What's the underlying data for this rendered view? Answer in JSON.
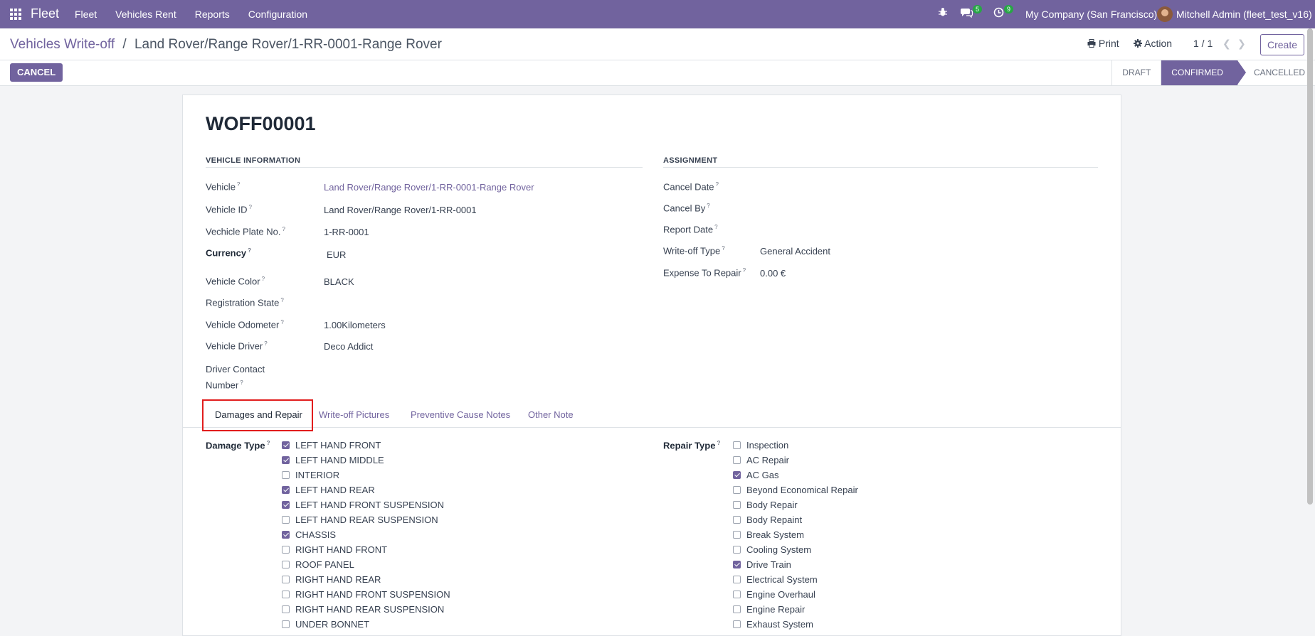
{
  "navbar": {
    "brand": "Fleet",
    "menu": [
      "Fleet",
      "Vehicles Rent",
      "Reports",
      "Configuration"
    ],
    "messages_count": "5",
    "activities_count": "9",
    "company": "My Company (San Francisco)",
    "user": "Mitchell Admin (fleet_test_v16)"
  },
  "control_panel": {
    "breadcrumb_parent": "Vehicles Write-off",
    "breadcrumb_sep": "/",
    "breadcrumb_current": "Land Rover/Range Rover/1-RR-0001-Range Rover",
    "print_label": "Print",
    "action_label": "Action",
    "pager": "1 / 1",
    "create_label": "Create",
    "cancel_label": "CANCEL",
    "statuses": [
      "DRAFT",
      "CONFIRMED",
      "CANCELLED"
    ],
    "active_status": "CONFIRMED"
  },
  "form": {
    "name": "WOFF00001",
    "vehicle_info_title": "VEHICLE INFORMATION",
    "assignment_title": "ASSIGNMENT",
    "vehicle_fields": [
      {
        "label": "Vehicle",
        "value": "Land Rover/Range Rover/1-RR-0001-Range Rover"
      },
      {
        "label": "Vehicle ID",
        "value": "Land Rover/Range Rover/1-RR-0001"
      },
      {
        "label": "Vechicle Plate No.",
        "value": "1-RR-0001"
      },
      {
        "label": "Currency",
        "value": "EUR"
      },
      {
        "label": "Vehicle Color",
        "value": "BLACK"
      },
      {
        "label": "Registration State",
        "value": ""
      },
      {
        "label": "Vehicle Odometer",
        "value": "1.00Kilometers"
      },
      {
        "label": "Vehicle Driver",
        "value": "Deco Addict"
      },
      {
        "label": "Driver Contact",
        "label2": "Number",
        "value": ""
      }
    ],
    "assignment_fields": [
      {
        "label": "Cancel Date",
        "value": ""
      },
      {
        "label": "Cancel By",
        "value": ""
      },
      {
        "label": "Report Date",
        "value": ""
      },
      {
        "label": "Write-off Type",
        "value": "General Accident"
      },
      {
        "label": "Expense To Repair",
        "value": "0.00 €"
      }
    ]
  },
  "tabs": [
    "Damages and Repair",
    "Write-off Pictures",
    "Preventive Cause Notes",
    "Other Note"
  ],
  "damage": {
    "label": "Damage Type",
    "options": [
      {
        "name": "LEFT HAND FRONT",
        "checked": true
      },
      {
        "name": "LEFT HAND MIDDLE",
        "checked": true
      },
      {
        "name": "INTERIOR",
        "checked": false
      },
      {
        "name": "LEFT HAND REAR",
        "checked": true
      },
      {
        "name": "LEFT HAND FRONT SUSPENSION",
        "checked": true
      },
      {
        "name": "LEFT HAND REAR SUSPENSION",
        "checked": false
      },
      {
        "name": "CHASSIS",
        "checked": true
      },
      {
        "name": "RIGHT HAND FRONT",
        "checked": false
      },
      {
        "name": "ROOF PANEL",
        "checked": false
      },
      {
        "name": "RIGHT HAND REAR",
        "checked": false
      },
      {
        "name": "RIGHT HAND FRONT SUSPENSION",
        "checked": false
      },
      {
        "name": "RIGHT HAND REAR SUSPENSION",
        "checked": false
      },
      {
        "name": "UNDER BONNET",
        "checked": false
      }
    ]
  },
  "repair": {
    "label": "Repair Type",
    "options": [
      {
        "name": "Inspection",
        "checked": false
      },
      {
        "name": "AC Repair",
        "checked": false
      },
      {
        "name": "AC Gas",
        "checked": true
      },
      {
        "name": "Beyond Economical Repair",
        "checked": false
      },
      {
        "name": "Body Repair",
        "checked": false
      },
      {
        "name": "Body Repaint",
        "checked": false
      },
      {
        "name": "Break System",
        "checked": false
      },
      {
        "name": "Cooling System",
        "checked": false
      },
      {
        "name": "Drive Train",
        "checked": true
      },
      {
        "name": "Electrical System",
        "checked": false
      },
      {
        "name": "Engine Overhaul",
        "checked": false
      },
      {
        "name": "Engine Repair",
        "checked": false
      },
      {
        "name": "Exhaust System",
        "checked": false
      }
    ]
  }
}
